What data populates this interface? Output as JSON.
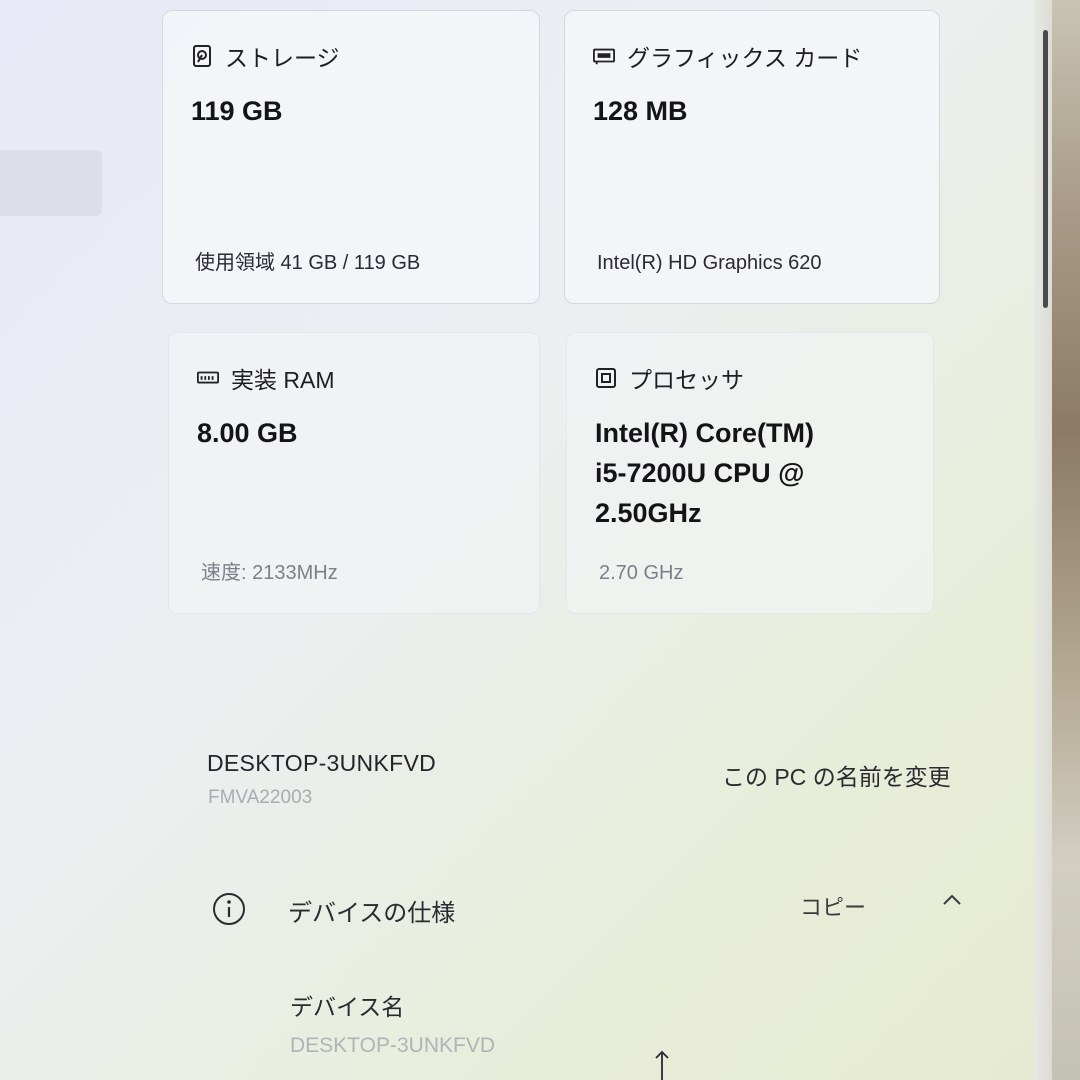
{
  "cards": {
    "storage": {
      "icon": "hard-drive-icon",
      "title": "ストレージ",
      "value": "119 GB",
      "detail": "使用領域 41 GB / 119 GB"
    },
    "gpu": {
      "icon": "graphics-card-icon",
      "title": "グラフィックス カード",
      "value": "128 MB",
      "detail": "Intel(R) HD Graphics 620"
    },
    "ram": {
      "icon": "memory-icon",
      "title": "実装 RAM",
      "value": "8.00 GB",
      "detail": "速度: 2133MHz"
    },
    "cpu": {
      "icon": "processor-icon",
      "title": "プロセッサ",
      "value_lines": [
        "Intel(R) Core(TM)",
        "i5-7200U CPU @",
        "2.50GHz"
      ],
      "detail": "2.70 GHz"
    }
  },
  "pc": {
    "name": "DESKTOP-3UNKFVD",
    "model": "FMVA22003",
    "rename_label": "この PC の名前を変更"
  },
  "device_spec": {
    "icon": "info-icon",
    "title": "デバイスの仕様",
    "copy_label": "コピー",
    "collapse_icon": "chevron-up-icon",
    "device_name_label": "デバイス名",
    "device_name_value": "DESKTOP-3UNKFVD"
  },
  "colors": {
    "text_primary": "#141416",
    "text_muted": "#7c8088",
    "card_bg": "#f5f6fa"
  }
}
